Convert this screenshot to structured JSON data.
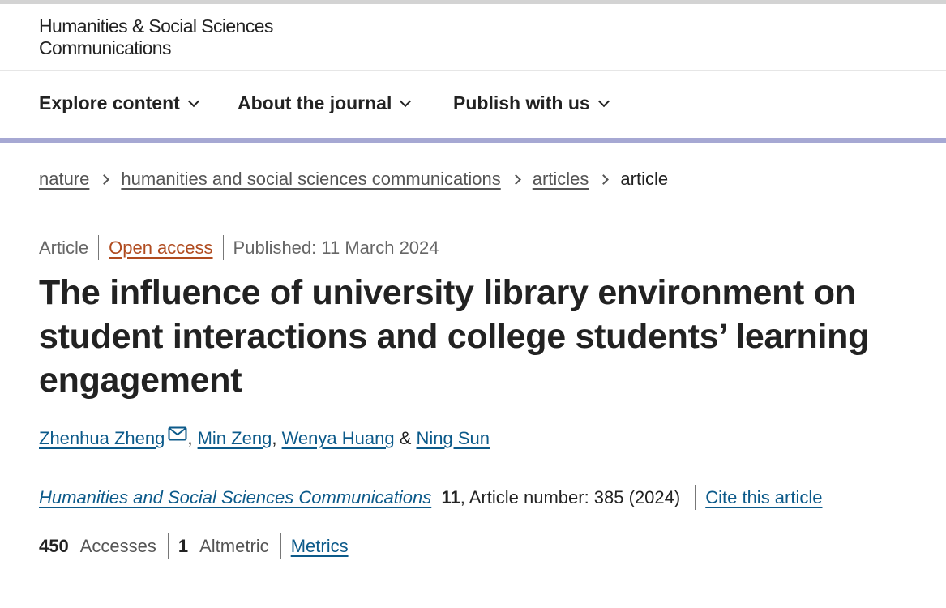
{
  "header": {
    "journal_logo_line1": "Humanities & Social Sciences",
    "journal_logo_line2": "Communications"
  },
  "nav": {
    "items": [
      {
        "label": "Explore content"
      },
      {
        "label": "About the journal"
      },
      {
        "label": "Publish with us"
      }
    ]
  },
  "breadcrumb": {
    "items": [
      "nature",
      "humanities and social sciences communications",
      "articles"
    ],
    "current": "article"
  },
  "article": {
    "type": "Article",
    "access": "Open access",
    "published": "Published: 11 March 2024",
    "title": "The influence of university library environment on student interactions and college students’ learning engagement",
    "authors": [
      {
        "name": "Zhenhua Zheng"
      },
      {
        "name": "Min Zeng"
      },
      {
        "name": "Wenya Huang"
      },
      {
        "name": "Ning Sun"
      }
    ],
    "author_sep_comma": ",",
    "author_sep_and": "&",
    "citation": {
      "journal": "Humanities and Social Sciences Communications",
      "volume": "11",
      "details": ", Article number: 385 (2024)",
      "cite_link": "Cite this article"
    },
    "metrics": {
      "accesses_count": "450",
      "accesses_label": "Accesses",
      "altmetric_count": "1",
      "altmetric_label": "Altmetric",
      "metrics_link": "Metrics"
    }
  },
  "colors": {
    "nav_rule": "#a6a8d3",
    "link": "#0c5a8a",
    "open_access": "#b04b1f"
  }
}
